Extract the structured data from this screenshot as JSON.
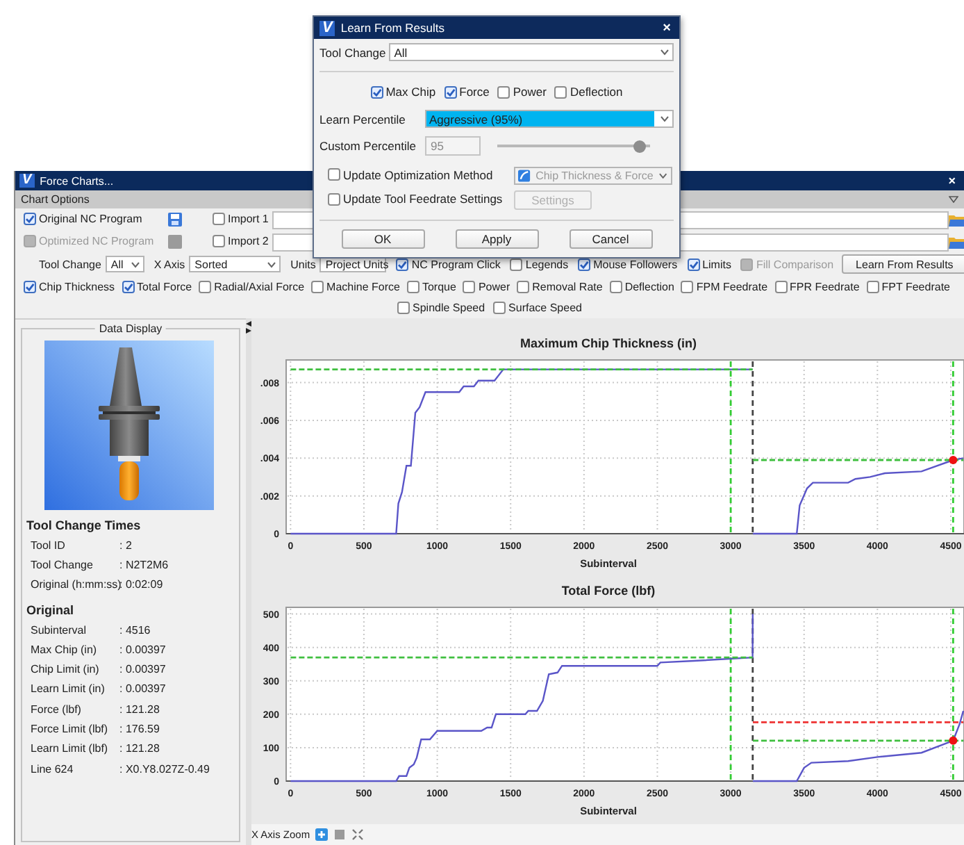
{
  "dialog": {
    "logo": "V",
    "title": "Learn From Results",
    "close": "×",
    "tool_change": {
      "label": "Tool Change",
      "value": "All"
    },
    "metrics": [
      {
        "label": "Max Chip",
        "checked": true
      },
      {
        "label": "Force",
        "checked": true
      },
      {
        "label": "Power",
        "checked": false
      },
      {
        "label": "Deflection",
        "checked": false
      }
    ],
    "learn_percentile": {
      "label": "Learn Percentile",
      "value": "Aggressive (95%)"
    },
    "custom_percentile": {
      "label": "Custom Percentile",
      "value": "95",
      "disabled": true,
      "level": 0.97
    },
    "options": [
      {
        "label": "Update Optimization Method",
        "checked": false,
        "kind": "dropdown",
        "control": "Chip Thickness & Force",
        "disabled": true
      },
      {
        "label": "Update Tool Feedrate Settings",
        "checked": false,
        "kind": "button",
        "control": "Settings",
        "disabled": true
      }
    ],
    "buttons": [
      "OK",
      "Apply",
      "Cancel"
    ]
  },
  "window": {
    "logo": "V",
    "title": "Force Charts...",
    "close": "×"
  },
  "chart_options": {
    "title": "Chart Options",
    "programs": [
      {
        "label": "Original NC Program",
        "checked": true,
        "disabled": false,
        "import": {
          "label": "Import 1",
          "checked": false
        }
      },
      {
        "label": "Optimized NC Program",
        "checked": false,
        "disabled": true,
        "import": {
          "label": "Import 2",
          "checked": false
        }
      }
    ],
    "selectors": [
      {
        "label": "Tool Change",
        "value": "All"
      },
      {
        "label": "X Axis",
        "value": "Sorted"
      },
      {
        "label": "Units",
        "value": "Project Units"
      }
    ],
    "toggles": [
      {
        "label": "NC Program Click",
        "checked": true,
        "disabled": false
      },
      {
        "label": "Legends",
        "checked": false,
        "disabled": false
      },
      {
        "label": "Mouse Followers",
        "checked": true,
        "disabled": false
      },
      {
        "label": "Limits",
        "checked": true,
        "disabled": false
      },
      {
        "label": "Fill Comparison",
        "checked": false,
        "disabled": true
      }
    ],
    "action": "Learn From Results",
    "series_rows": [
      [
        {
          "label": "Chip Thickness",
          "checked": true
        },
        {
          "label": "Total Force",
          "checked": true
        },
        {
          "label": "Radial/Axial Force",
          "checked": false
        },
        {
          "label": "Machine Force",
          "checked": false
        },
        {
          "label": "Torque",
          "checked": false
        },
        {
          "label": "Power",
          "checked": false
        },
        {
          "label": "Removal Rate",
          "checked": false
        },
        {
          "label": "Deflection",
          "checked": false
        },
        {
          "label": "FPM Feedrate",
          "checked": false
        },
        {
          "label": "FPR Feedrate",
          "checked": false
        },
        {
          "label": "FPT Feedrate",
          "checked": false
        }
      ],
      [
        {
          "label": "Spindle Speed",
          "checked": false
        },
        {
          "label": "Surface Speed",
          "checked": false
        }
      ]
    ]
  },
  "data_display": {
    "title": "Data Display",
    "sections": [
      {
        "heading": "Tool Change Times",
        "rows": [
          {
            "label": "Tool ID",
            "value": ": 2"
          },
          {
            "label": "Tool Change",
            "value": ": N2T2M6"
          },
          {
            "label": "Original (h:mm:ss)",
            "value": ": 0:02:09"
          }
        ]
      },
      {
        "heading": "Original",
        "rows": [
          {
            "label": "Subinterval",
            "value": ": 4516"
          },
          {
            "label": "Max Chip (in)",
            "value": ": 0.00397"
          },
          {
            "label": "Chip Limit (in)",
            "value": ": 0.00397"
          },
          {
            "label": "Learn Limit (in)",
            "value": ": 0.00397"
          },
          {
            "label": "Force (lbf)",
            "value": ": 121.28"
          },
          {
            "label": "Force Limit (lbf)",
            "value": ": 176.59"
          },
          {
            "label": "Learn Limit (lbf)",
            "value": ": 121.28"
          },
          {
            "label": "Line 624",
            "value": ": X0.Y8.027Z-0.49"
          }
        ]
      }
    ]
  },
  "charts": [
    {
      "chart_data": {
        "type": "line",
        "title": "Maximum Chip Thickness (in)",
        "xlabel": "Subinterval",
        "grid": true,
        "x": [
          0,
          720,
          735,
          760,
          790,
          820,
          850,
          880,
          920,
          1150,
          1180,
          1250,
          1280,
          1390,
          1450,
          3149,
          3151,
          3450,
          3470,
          3520,
          3560,
          3800,
          3850,
          3950,
          4050,
          4300,
          4516,
          4585
        ],
        "series": [
          {
            "color": "#5a55c8",
            "line_style": "solid",
            "values": [
              0,
              0,
              0.0016,
              0.0022,
              0.0036,
              0.0036,
              0.0064,
              0.0067,
              0.0075,
              0.0075,
              0.0078,
              0.0078,
              0.0081,
              0.0081,
              0.0087,
              0.0087,
              null,
              null,
              null,
              null,
              null,
              null,
              null,
              null,
              null,
              null,
              null,
              null
            ]
          },
          {
            "color": "#5a55c8",
            "line_style": "solid",
            "values": [
              null,
              null,
              null,
              null,
              null,
              null,
              null,
              null,
              null,
              null,
              null,
              null,
              null,
              null,
              null,
              null,
              0,
              0,
              0.0015,
              0.0024,
              0.0027,
              0.0027,
              0.0029,
              0.003,
              0.0032,
              0.0033,
              0.0039,
              0.004
            ]
          },
          {
            "color": "#3fbf3f",
            "line_style": "dashed",
            "values": [
              0.0087,
              0.0087,
              0.0087,
              0.0087,
              0.0087,
              0.0087,
              0.0087,
              0.0087,
              0.0087,
              0.0087,
              0.0087,
              0.0087,
              0.0087,
              0.0087,
              0.0087,
              0.0087,
              null,
              null,
              null,
              null,
              null,
              null,
              null,
              null,
              null,
              null,
              null,
              null
            ]
          },
          {
            "color": "#3fbf3f",
            "line_style": "dashed",
            "values": [
              null,
              null,
              null,
              null,
              null,
              null,
              null,
              null,
              null,
              null,
              null,
              null,
              null,
              null,
              null,
              null,
              0.0039,
              0.0039,
              0.0039,
              0.0039,
              0.0039,
              0.0039,
              0.0039,
              0.0039,
              0.0039,
              0.0039,
              0.0039,
              0.0039
            ]
          },
          {
            "color": "#ee1111",
            "line_style": "none",
            "marker": "circle",
            "values": [
              null,
              null,
              null,
              null,
              null,
              null,
              null,
              null,
              null,
              null,
              null,
              null,
              null,
              null,
              null,
              null,
              null,
              null,
              null,
              null,
              null,
              null,
              null,
              null,
              null,
              null,
              0.0039,
              null
            ]
          }
        ],
        "xlim": [
          -30,
          4590
        ],
        "ylim": [
          0,
          0.0092
        ],
        "xticks": [
          0,
          500,
          1000,
          1500,
          2000,
          2500,
          3000,
          3500,
          4000,
          4500
        ],
        "yticks": [
          0,
          {
            "value": 0.002,
            "label": ".002"
          },
          {
            "value": 0.004,
            "label": ".004"
          },
          {
            "value": 0.006,
            "label": ".006"
          },
          {
            "value": 0.008,
            "label": ".008"
          }
        ],
        "ref_lines": [
          {
            "axis": "x",
            "value": 3000,
            "color": "#33cc33",
            "line_style": "dashed"
          },
          {
            "axis": "x",
            "value": 3150,
            "color": "#444444",
            "line_style": "dashed"
          },
          {
            "axis": "x",
            "value": 4516,
            "color": "#33cc33",
            "line_style": "dashed"
          }
        ]
      }
    },
    {
      "chart_data": {
        "type": "line",
        "title": "Total Force (lbf)",
        "xlabel": "Subinterval",
        "grid": true,
        "x": [
          0,
          720,
          740,
          790,
          810,
          840,
          860,
          890,
          950,
          1000,
          1300,
          1340,
          1370,
          1400,
          1600,
          1620,
          1680,
          1720,
          1760,
          1820,
          1850,
          2500,
          2520,
          2750,
          3149,
          3150,
          3151,
          3450,
          3500,
          3550,
          3800,
          4000,
          4300,
          4516,
          4560,
          4585
        ],
        "series": [
          {
            "color": "#5a55c8",
            "line_style": "solid",
            "values": [
              0,
              0,
              15,
              15,
              40,
              50,
              70,
              125,
              125,
              150,
              150,
              160,
              160,
              200,
              200,
              210,
              210,
              240,
              320,
              325,
              345,
              345,
              355,
              360,
              370,
              500,
              null,
              null,
              null,
              null,
              null,
              null,
              null,
              null,
              null,
              null
            ]
          },
          {
            "color": "#5a55c8",
            "line_style": "solid",
            "values": [
              null,
              null,
              null,
              null,
              null,
              null,
              null,
              null,
              null,
              null,
              null,
              null,
              null,
              null,
              null,
              null,
              null,
              null,
              null,
              null,
              null,
              null,
              null,
              null,
              null,
              null,
              0,
              0,
              40,
              55,
              60,
              72,
              85,
              121,
              170,
              210
            ]
          },
          {
            "color": "#3fbf3f",
            "line_style": "dashed",
            "values": [
              370,
              370,
              370,
              370,
              370,
              370,
              370,
              370,
              370,
              370,
              370,
              370,
              370,
              370,
              370,
              370,
              370,
              370,
              370,
              370,
              370,
              370,
              370,
              370,
              370,
              370,
              null,
              null,
              null,
              null,
              null,
              null,
              null,
              null,
              null,
              null
            ]
          },
          {
            "color": "#3fbf3f",
            "line_style": "dashed",
            "values": [
              null,
              null,
              null,
              null,
              null,
              null,
              null,
              null,
              null,
              null,
              null,
              null,
              null,
              null,
              null,
              null,
              null,
              null,
              null,
              null,
              null,
              null,
              null,
              null,
              null,
              null,
              121,
              121,
              121,
              121,
              121,
              121,
              121,
              121,
              121,
              121
            ]
          },
          {
            "color": "#ee3333",
            "line_style": "dashed",
            "values": [
              null,
              null,
              null,
              null,
              null,
              null,
              null,
              null,
              null,
              null,
              null,
              null,
              null,
              null,
              null,
              null,
              null,
              null,
              null,
              null,
              null,
              null,
              null,
              null,
              null,
              null,
              176,
              176,
              176,
              176,
              176,
              176,
              176,
              176,
              176,
              176
            ]
          },
          {
            "color": "#ee1111",
            "line_style": "none",
            "marker": "circle",
            "values": [
              null,
              null,
              null,
              null,
              null,
              null,
              null,
              null,
              null,
              null,
              null,
              null,
              null,
              null,
              null,
              null,
              null,
              null,
              null,
              null,
              null,
              null,
              null,
              null,
              null,
              null,
              null,
              null,
              null,
              null,
              null,
              null,
              null,
              121,
              null,
              null
            ]
          }
        ],
        "xlim": [
          -30,
          4590
        ],
        "ylim": [
          0,
          520
        ],
        "xticks": [
          0,
          500,
          1000,
          1500,
          2000,
          2500,
          3000,
          3500,
          4000,
          4500
        ],
        "yticks": [
          0,
          100,
          200,
          300,
          400,
          500
        ],
        "ref_lines": [
          {
            "axis": "x",
            "value": 3000,
            "color": "#33cc33",
            "line_style": "dashed"
          },
          {
            "axis": "x",
            "value": 3150,
            "color": "#444444",
            "line_style": "dashed"
          },
          {
            "axis": "x",
            "value": 4516,
            "color": "#33cc33",
            "line_style": "dashed"
          }
        ]
      }
    }
  ],
  "zoom_bar": {
    "label": "X Axis Zoom"
  }
}
